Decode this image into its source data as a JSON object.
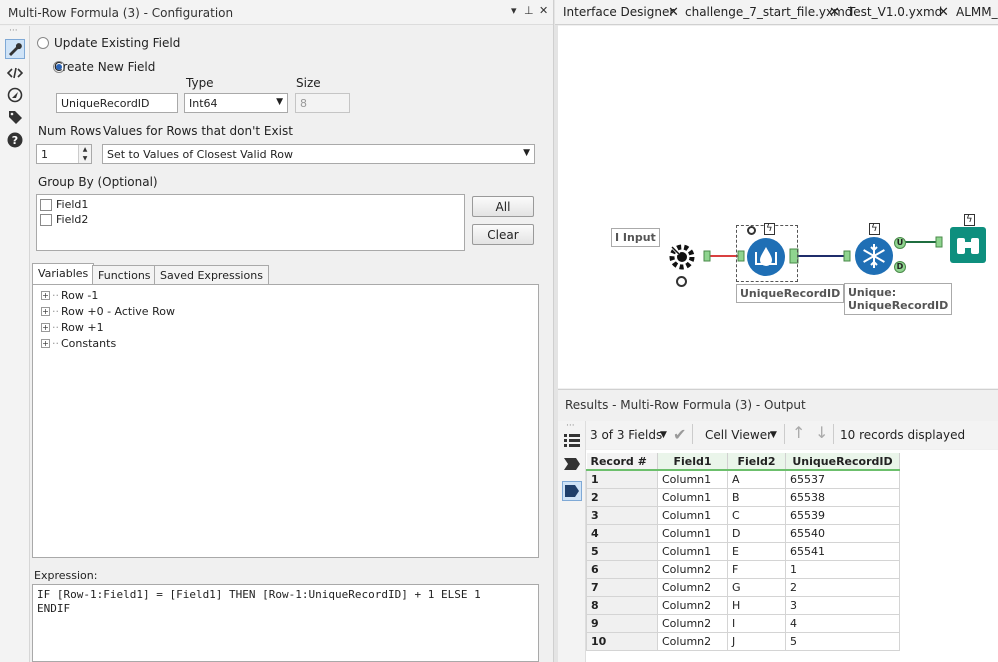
{
  "config": {
    "title": "Multi-Row Formula (3) - Configuration",
    "title_controls": {
      "dropdown": "▾",
      "pin": "⊥",
      "close": "✕"
    },
    "update_existing_label": "Update Existing Field",
    "create_new_label": "Create New  Field",
    "selected_mode": "create_new",
    "type_label": "Type",
    "size_label": "Size",
    "new_field_name": "UniqueRecordID",
    "type_value": "Int64",
    "size_value": "8",
    "num_rows_label": "Num Rows",
    "num_rows_value": "1",
    "values_for_rows_label": "Values for Rows that don't Exist",
    "values_for_rows_value": "Set to Values of Closest Valid Row",
    "group_by_label": "Group By (Optional)",
    "group_by_fields": [
      {
        "name": "Field1",
        "checked": false
      },
      {
        "name": "Field2",
        "checked": false
      }
    ],
    "all_button": "All",
    "clear_button": "Clear",
    "tabs": [
      "Variables",
      "Functions",
      "Saved Expressions"
    ],
    "active_tab": "Variables",
    "variables_tree": [
      "Row -1",
      "Row +0 - Active Row",
      "Row +1",
      "Constants"
    ],
    "expression_label": "Expression:",
    "expression_lines": [
      "IF [Row-1:Field1] = [Field1] THEN [Row-1:UniqueRecordID] + 1 ELSE 1",
      "ENDIF"
    ]
  },
  "toolstrip_icons": [
    "wrench-icon",
    "code-icon",
    "navigate-icon",
    "tag-icon",
    "help-icon"
  ],
  "doc_tabs": [
    {
      "label": "Interface Designer"
    },
    {
      "label": "challenge_7_start_file.yxmd"
    },
    {
      "label": "Test_V1.0.yxmd"
    },
    {
      "label": "ALMM_C"
    }
  ],
  "canvas": {
    "input_label": "I Input",
    "multirow_label": "UniqueRecordID",
    "unique_label_lines": [
      "Unique:",
      "UniqueRecordID"
    ],
    "anchor_letters": {
      "u": "U",
      "d": "D"
    }
  },
  "results": {
    "title": "Results - Multi-Row Formula (3) - Output",
    "fields_selector": "3 of 3 Fields",
    "cell_viewer": "Cell Viewer",
    "records_displayed": "10 records displayed",
    "columns": [
      "Record #",
      "Field1",
      "Field2",
      "UniqueRecordID"
    ],
    "rows": [
      [
        "1",
        "Column1",
        "A",
        "65537"
      ],
      [
        "2",
        "Column1",
        "B",
        "65538"
      ],
      [
        "3",
        "Column1",
        "C",
        "65539"
      ],
      [
        "4",
        "Column1",
        "D",
        "65540"
      ],
      [
        "5",
        "Column1",
        "E",
        "65541"
      ],
      [
        "6",
        "Column2",
        "F",
        "1"
      ],
      [
        "7",
        "Column2",
        "G",
        "2"
      ],
      [
        "8",
        "Column2",
        "H",
        "3"
      ],
      [
        "9",
        "Column2",
        "I",
        "4"
      ],
      [
        "10",
        "Column2",
        "J",
        "5"
      ]
    ]
  },
  "colors": {
    "accent_blue": "#1f6fb5",
    "connection_red": "#d94040",
    "connection_navy": "#1f2d6b",
    "results_green": "#6cbf6c",
    "browse_teal": "#0e8f7e"
  }
}
